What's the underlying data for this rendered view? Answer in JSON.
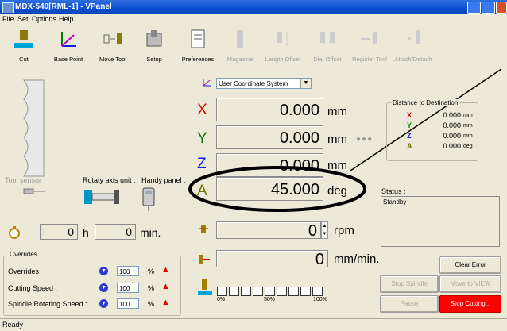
{
  "window": {
    "title": "MDX-540[RML-1] - VPanel"
  },
  "menu": [
    "File",
    "Set",
    "Options",
    "Help"
  ],
  "toolbar": [
    {
      "label": "Cut",
      "icon": "cut-icon",
      "enabled": true
    },
    {
      "label": "Base Point",
      "icon": "base-point-icon",
      "enabled": true
    },
    {
      "label": "Move Tool",
      "icon": "move-tool-icon",
      "enabled": true
    },
    {
      "label": "Setup",
      "icon": "setup-icon",
      "enabled": true
    },
    {
      "label": "Preferences",
      "icon": "preferences-icon",
      "enabled": true
    },
    {
      "label": "Magazine",
      "icon": "magazine-icon",
      "enabled": false
    },
    {
      "label": "Length Offset",
      "icon": "length-offset-icon",
      "enabled": false
    },
    {
      "label": "Dia. Offset",
      "icon": "dia-offset-icon",
      "enabled": false
    },
    {
      "label": "Register Tool",
      "icon": "register-tool-icon",
      "enabled": false
    },
    {
      "label": "Attach/Detach",
      "icon": "attach-detach-icon",
      "enabled": false
    }
  ],
  "coordinate_system": "User Coordinate System",
  "axes": [
    {
      "letter": "X",
      "value": "0.000",
      "unit": "mm",
      "color": "#e00000"
    },
    {
      "letter": "Y",
      "value": "0.000",
      "unit": "mm",
      "color": "#008000"
    },
    {
      "letter": "Z",
      "value": "0.000",
      "unit": "mm",
      "color": "#1020e0"
    },
    {
      "letter": "A",
      "value": "45.000",
      "unit": "deg",
      "color": "#707000"
    }
  ],
  "distance": {
    "title": "Distance to Destination",
    "rows": [
      {
        "letter": "X",
        "value": "0.000",
        "unit": "mm",
        "color": "#e00000"
      },
      {
        "letter": "Y",
        "value": "0.000",
        "unit": "mm",
        "color": "#008000"
      },
      {
        "letter": "Z",
        "value": "0.000",
        "unit": "mm",
        "color": "#1020e0"
      },
      {
        "letter": "A",
        "value": "0.000",
        "unit": "deg",
        "color": "#707000"
      }
    ]
  },
  "labels": {
    "tool_sensor": "Tool sensor",
    "rotary_axis": "Rotaty axis unit :",
    "handy_panel": "Handy panel :",
    "status": "Status :",
    "status_value": "Standby",
    "overrides_group": "Overrides"
  },
  "time": {
    "hours": "0",
    "h": "h",
    "minutes": "0",
    "min": "min."
  },
  "spindle": {
    "value": "0",
    "unit": "rpm"
  },
  "feed": {
    "value": "0",
    "unit": "mm/min."
  },
  "overrides": [
    {
      "label": "Overrides",
      "value": "100",
      "unit": "%"
    },
    {
      "label": "Cutting Speed :",
      "value": "100",
      "unit": "%"
    },
    {
      "label": "Spindle Rotating Speed :",
      "value": "100",
      "unit": "%"
    }
  ],
  "progress": {
    "ticks": [
      "0%",
      "50%",
      "100%"
    ],
    "fill": 0
  },
  "buttons": {
    "clear_error": "Clear Error",
    "stop_spindle": "Stop Spindle",
    "move_to_view": "Move to VIEW",
    "pause": "Pause",
    "stop_cutting": "Stop Cutting..."
  },
  "statusbar": "Ready",
  "accent": {
    "stop": "#ff0000",
    "title": "#0a4ed0"
  }
}
